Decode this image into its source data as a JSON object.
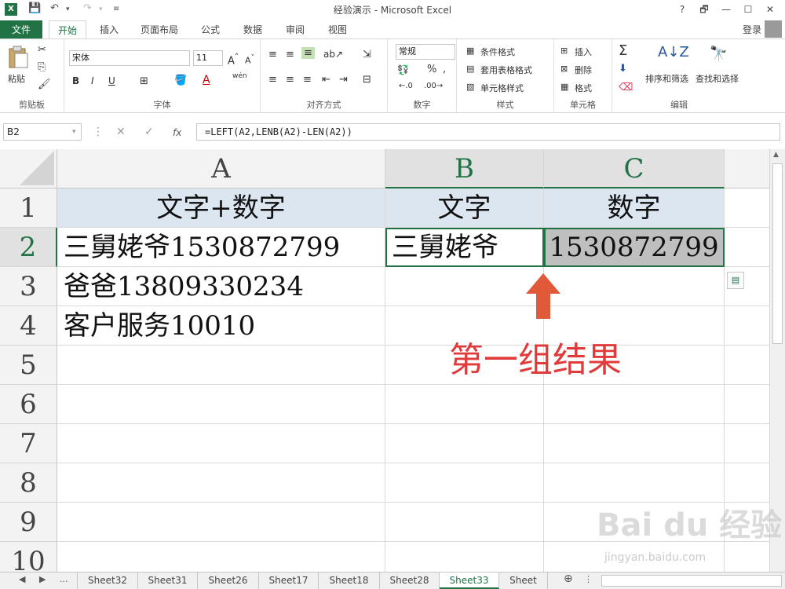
{
  "window": {
    "title": "经验演示 - Microsoft Excel",
    "help": "?",
    "controls": [
      "🗗",
      "—",
      "☐",
      "✕"
    ]
  },
  "tabs": {
    "file": "文件",
    "items": [
      "开始",
      "插入",
      "页面布局",
      "公式",
      "数据",
      "审阅",
      "视图"
    ],
    "login": "登录"
  },
  "ribbon": {
    "clipboard": {
      "paste": "粘贴",
      "label": "剪贴板"
    },
    "font": {
      "name": "宋体",
      "size": "11",
      "bold": "B",
      "italic": "I",
      "underline": "U",
      "wen": "wén",
      "label": "字体"
    },
    "align": {
      "label": "对齐方式"
    },
    "number": {
      "format": "常规",
      "percent": "%",
      "comma": ",",
      "label": "数字"
    },
    "styles": {
      "cond": "条件格式",
      "table": "套用表格格式",
      "cell": "单元格样式",
      "label": "样式"
    },
    "cells": {
      "insert": "插入",
      "delete": "删除",
      "format": "格式",
      "label": "单元格"
    },
    "editing": {
      "sort": "排序和筛选",
      "find": "查找和选择",
      "label": "编辑"
    }
  },
  "formula_bar": {
    "name_box": "B2",
    "cancel": "✕",
    "enter": "✓",
    "fx": "fx",
    "formula": "=LEFT(A2,LENB(A2)-LEN(A2))"
  },
  "grid": {
    "columns": [
      "A",
      "B",
      "C"
    ],
    "rows": [
      "1",
      "2",
      "3",
      "4",
      "5",
      "6",
      "7",
      "8",
      "9",
      "10"
    ],
    "cells": {
      "A1": "文字+数字",
      "B1": "文字",
      "C1": "数字",
      "A2": "三舅姥爷1530872799",
      "B2": "三舅姥爷",
      "C2": "1530872799",
      "A3": "爸爸13809330234",
      "A4": "客户服务10010"
    },
    "annotation": "第一组结果",
    "colors": {
      "header_fill": "#dce6f1",
      "gray_fill": "#bfbfbf",
      "accent": "#217346",
      "annotation": "#e03a3a"
    }
  },
  "sheets": {
    "ellipsis": "...",
    "tabs": [
      "Sheet32",
      "Sheet31",
      "Sheet26",
      "Sheet17",
      "Sheet18",
      "Sheet28",
      "Sheet33",
      "Sheet"
    ],
    "active": "Sheet33",
    "add": "⊕"
  },
  "watermark": {
    "brand": "Bai du 经验",
    "url": "jingyan.baidu.com"
  }
}
